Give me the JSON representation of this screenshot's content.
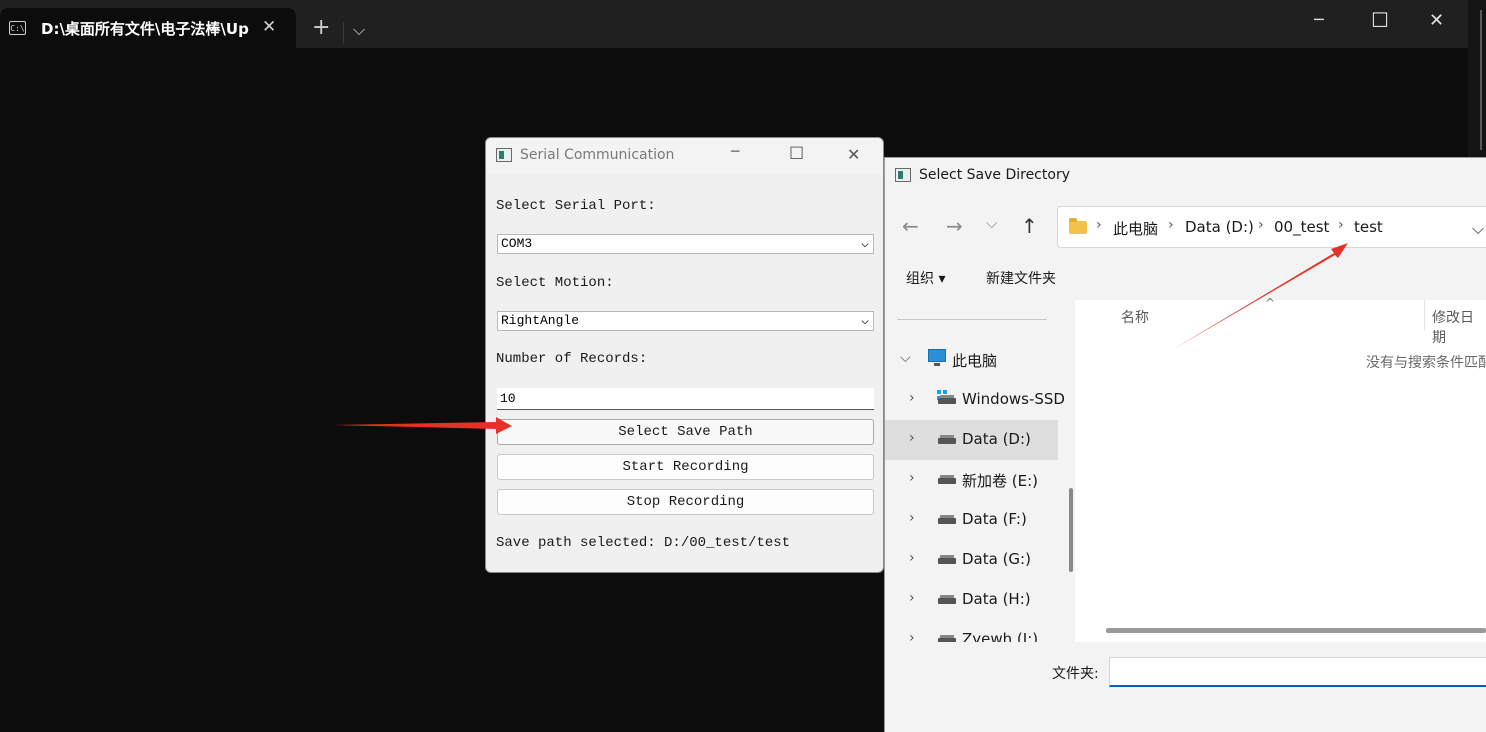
{
  "terminal": {
    "tab_title": "D:\\桌面所有文件\\电子法棒\\Up",
    "tab_icon_text": "C:\\",
    "tab_close": "✕",
    "new_tab": "+",
    "dropdown": "⌵",
    "minimize": "─",
    "maximize": "☐",
    "close": "✕"
  },
  "serial_window": {
    "title": "Serial Communication",
    "minimize": "─",
    "maximize": "☐",
    "close": "✕",
    "port_label": "Select Serial Port:",
    "port_value": "COM3",
    "motion_label": "Select Motion:",
    "motion_value": "RightAngle",
    "records_label": "Number of Records:",
    "records_value": "10",
    "select_save_path_button": "Select Save Path",
    "start_recording_button": "Start Recording",
    "stop_recording_button": "Stop Recording",
    "status_text": "Save path selected: D:/00_test/test",
    "chevron": "⌵"
  },
  "save_dialog": {
    "title": "Select Save Directory",
    "nav": {
      "back": "←",
      "forward": "→",
      "recent": "⌵",
      "up": "↑"
    },
    "breadcrumb": [
      "此电脑",
      "Data (D:)",
      "00_test",
      "test"
    ],
    "breadcrumb_sep": "›",
    "address_dropdown": "⌵",
    "toolbar": {
      "organize": "组织 ▾",
      "new_folder": "新建文件夹"
    },
    "tree": [
      {
        "label": "此电脑",
        "expanded": true
      },
      {
        "label": "Windows-SSD"
      },
      {
        "label": "Data (D:)",
        "selected": true
      },
      {
        "label": "新加卷 (E:)"
      },
      {
        "label": "Data (F:)"
      },
      {
        "label": "Data (G:)"
      },
      {
        "label": "Data (H:)"
      },
      {
        "label": "Zyewh (I:)"
      }
    ],
    "tree_chev_expanded": "⌵",
    "tree_chev_collapsed": "›",
    "columns": {
      "name": "名称",
      "modified": "修改日期"
    },
    "sort_indicator": "^",
    "empty_message": "没有与搜索条件匹配的项。",
    "folder_label": "文件夹:",
    "folder_value": ""
  },
  "colors": {
    "arrow": "#e53226",
    "terminal_bg": "#0c0c0c",
    "accent": "#005fb8"
  }
}
